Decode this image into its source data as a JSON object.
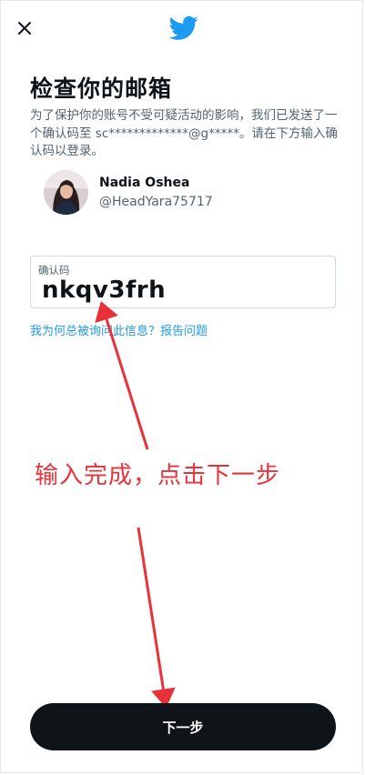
{
  "header": {
    "close_icon": "close-icon",
    "logo_icon": "twitter-bird-icon",
    "brand_color": "#1d9bf0"
  },
  "main": {
    "title": "检查你的邮箱",
    "description": "为了保护你的账号不受可疑活动的影响，我们已发送了一个确认码至 sc*************@g*****。请在下方输入确认码以登录。"
  },
  "account": {
    "name": "Nadia Oshea",
    "handle": "@HeadYara75717"
  },
  "code_field": {
    "label": "确认码",
    "value": "nkqv3frh"
  },
  "help_link": "我为何总被询问此信息？报告问题",
  "annotation": {
    "text": "输入完成，点击下一步",
    "color": "#e8323a"
  },
  "footer": {
    "next_label": "下一步",
    "button_color": "#0f1419"
  }
}
